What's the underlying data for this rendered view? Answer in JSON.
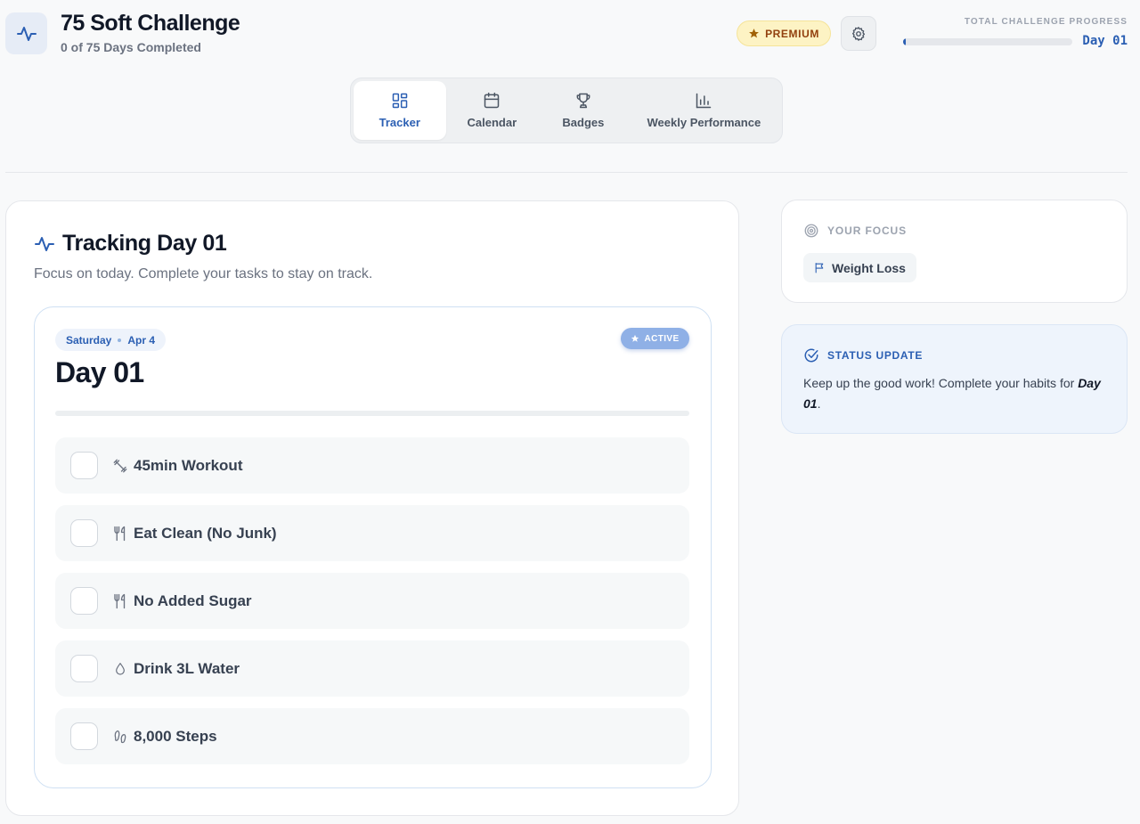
{
  "header": {
    "title": "75 Soft Challenge",
    "subtitle": "0 of 75 Days Completed",
    "premium_label": "PREMIUM",
    "progress_label": "TOTAL CHALLENGE PROGRESS",
    "progress_day": "Day 01",
    "progress_fraction": 0.01
  },
  "tabs": [
    {
      "label": "Tracker",
      "icon": "dashboard-icon",
      "active": true
    },
    {
      "label": "Calendar",
      "icon": "calendar-icon",
      "active": false
    },
    {
      "label": "Badges",
      "icon": "trophy-icon",
      "active": false
    },
    {
      "label": "Weekly Performance",
      "icon": "bar-chart-icon",
      "active": false
    }
  ],
  "tracker": {
    "title": "Tracking Day 01",
    "subtitle": "Focus on today. Complete your tasks to stay on track.",
    "weekday": "Saturday",
    "date": "Apr 4",
    "status_badge": "ACTIVE",
    "day_heading": "Day 01",
    "day_progress_fraction": 0,
    "tasks": [
      {
        "label": "45min Workout",
        "icon": "dumbbell-icon",
        "done": false
      },
      {
        "label": "Eat Clean (No Junk)",
        "icon": "utensils-icon",
        "done": false
      },
      {
        "label": "No Added Sugar",
        "icon": "utensils-icon",
        "done": false
      },
      {
        "label": "Drink 3L Water",
        "icon": "droplet-icon",
        "done": false
      },
      {
        "label": "8,000 Steps",
        "icon": "footprints-icon",
        "done": false
      }
    ]
  },
  "focus": {
    "label": "YOUR FOCUS",
    "value": "Weight Loss"
  },
  "status": {
    "label": "STATUS UPDATE",
    "text_prefix": "Keep up the good work! Complete your habits for",
    "text_day": "Day 01",
    "text_suffix": "."
  },
  "colors": {
    "accent": "#2b5fb3",
    "premium_bg": "#fdf3c4",
    "premium_text": "#92400e",
    "active_badge": "#8fb0e6",
    "status_bg": "#eef4fc"
  }
}
